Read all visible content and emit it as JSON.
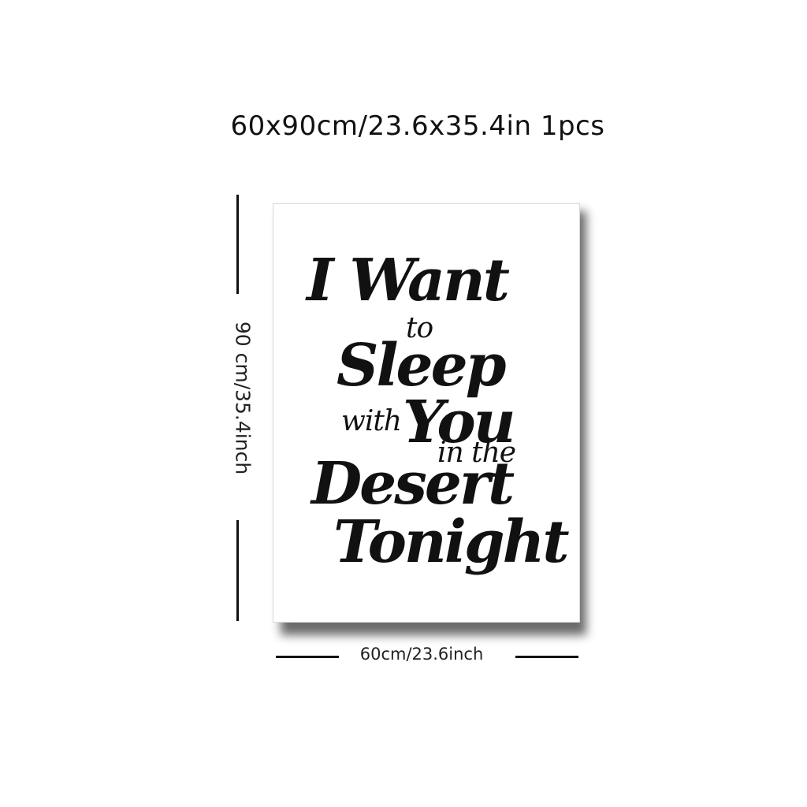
{
  "header": {
    "size_text": "60x90cm/23.6x35.4in",
    "quantity_text": "1pcs"
  },
  "poster": {
    "lines": [
      "I Want",
      "to",
      "Sleep",
      "with",
      "You",
      "in the",
      "Desert",
      "Tonight"
    ]
  },
  "dimensions": {
    "width_label": "60cm/23.6inch",
    "height_label": "90 cm/35.4inch"
  },
  "colors": {
    "text": "#111111",
    "background": "#ffffff",
    "shadow": "#3a3a3a"
  }
}
